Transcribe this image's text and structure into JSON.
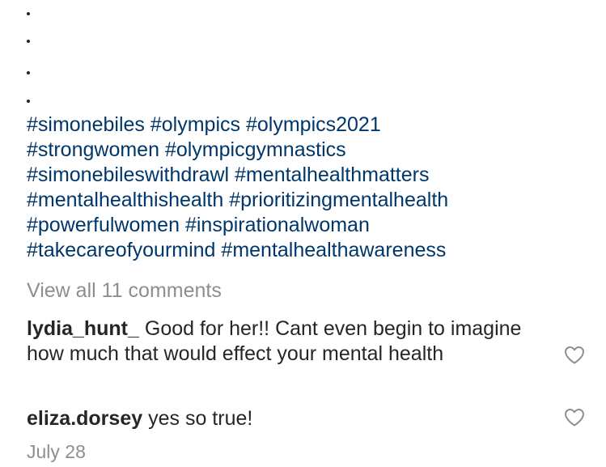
{
  "caption": {
    "dots": [
      ".",
      ".",
      ".",
      "."
    ],
    "hashtag_lines": [
      [
        "#simonebiles",
        "#olympics",
        "#olympics2021"
      ],
      [
        "#strongwomen",
        "#olympicgymnastics"
      ],
      [
        "#simonebileswithdrawl",
        "#mentalhealthmatters"
      ],
      [
        "#mentalhealthishealth",
        "#prioritizingmentalhealth"
      ],
      [
        "#powerfulwomen",
        "#inspirationalwoman"
      ],
      [
        "#takecareofyourmind",
        "#mentalhealthawareness"
      ]
    ]
  },
  "comments_link": "View all 11 comments",
  "comments": [
    {
      "username": "lydia_hunt_",
      "text": "Good for her!! Cant even begin to imagine how much that would effect your mental health"
    },
    {
      "username": "eliza.dorsey",
      "text": "yes so true!"
    }
  ],
  "like_icon": "heart-outline-icon",
  "post_date": "July 28",
  "colors": {
    "hashtag": "#00376b",
    "muted": "#8e8e8e",
    "text": "#262626"
  }
}
